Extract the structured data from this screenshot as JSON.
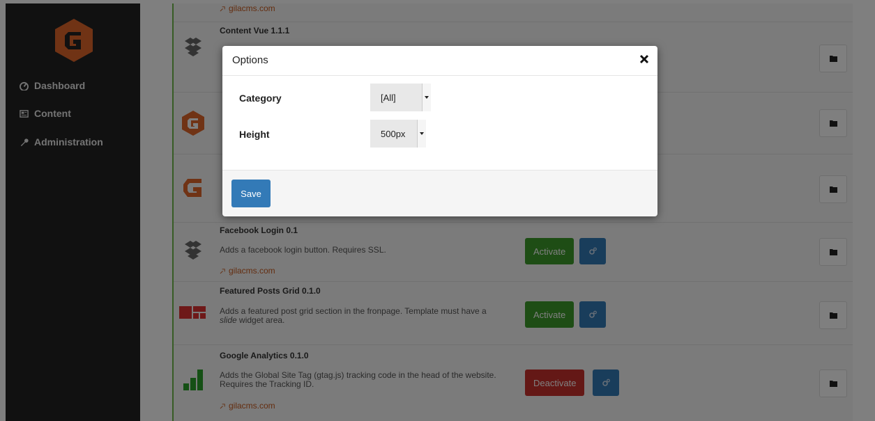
{
  "colors": {
    "sidebar_bg": "#222222",
    "brand": "#e0662b",
    "activate": "#3c9a2a",
    "deactivate": "#c9302c",
    "primary": "#337ab7",
    "link": "#c85a1f"
  },
  "sidebar": {
    "items": [
      {
        "label": "Dashboard",
        "icon": "dashboard-icon"
      },
      {
        "label": "Content",
        "icon": "newspaper-icon"
      },
      {
        "label": "Administration",
        "icon": "wrench-icon"
      }
    ]
  },
  "packages": [
    {
      "title": "",
      "desc": "",
      "link": "gilacms.com"
    },
    {
      "title": "Content Vue 1.1.1",
      "desc": "",
      "link": ""
    },
    {
      "title": "Facebook Login 0.1",
      "desc": "Adds a facebook login button. Requires SSL.",
      "link": "gilacms.com",
      "action": "Activate"
    },
    {
      "title": "Featured Posts Grid 0.1.0",
      "desc_parts": [
        "Adds a featured post grid section in the fronpage. Template must have a ",
        "slide",
        " widget area."
      ],
      "action": "Activate"
    },
    {
      "title": "Google Analytics 0.1.0",
      "desc": "Adds the Global Site Tag (gtag.js) tracking code in the head of the website. Requires the Tracking ID.",
      "link": "gilacms.com",
      "action": "Deactivate"
    }
  ],
  "modal": {
    "title": "Options",
    "fields": [
      {
        "label": "Category",
        "value": "[All]"
      },
      {
        "label": "Height",
        "value": "500px"
      }
    ],
    "save_label": "Save"
  }
}
